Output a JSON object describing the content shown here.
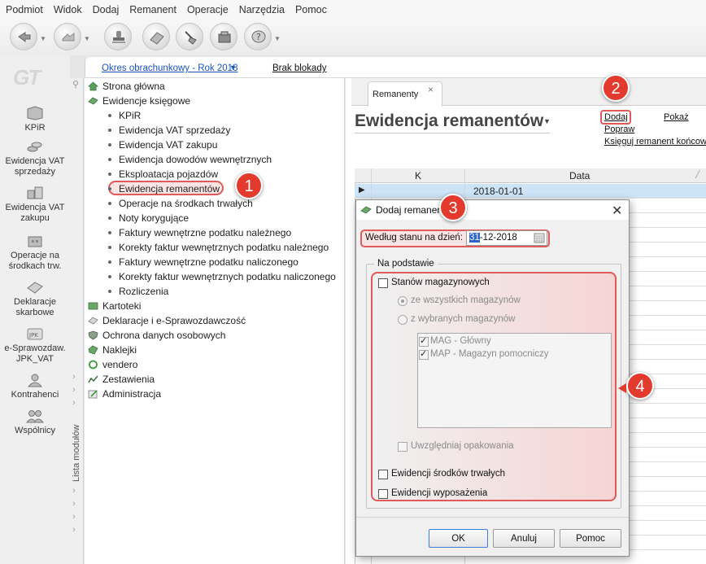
{
  "menu": [
    "Podmiot",
    "Widok",
    "Dodaj",
    "Remanent",
    "Operacje",
    "Narzędzia",
    "Pomoc"
  ],
  "toolbar_icons": [
    "back-arrow-icon",
    "forward-arrow-icon",
    "stamp-icon",
    "eraser-icon",
    "broom-icon",
    "register-icon",
    "help-icon"
  ],
  "logo": "GT",
  "left_nav": [
    {
      "label": "KPiR",
      "icon": "book-icon"
    },
    {
      "label": "Ewidencja VAT sprzedaży",
      "icon": "coins-icon"
    },
    {
      "label": "Ewidencja VAT zakupu",
      "icon": "boxes-icon"
    },
    {
      "label": "Operacje na środkach trw.",
      "icon": "building-icon"
    },
    {
      "label": "Deklaracje skarbowe",
      "icon": "forms-icon"
    },
    {
      "label": "e-Sprawozdaw. JPK_VAT",
      "icon": "jpk-icon"
    },
    {
      "label": "Kontrahenci",
      "icon": "person-icon"
    },
    {
      "label": "Wspólnicy",
      "icon": "people-icon"
    }
  ],
  "header": {
    "okres": "Okres obrachunkowy - Rok 2018",
    "brak": "Brak blokady"
  },
  "module_list_label": "Lista modułów",
  "tree": {
    "top": [
      {
        "label": "Strona główna",
        "icon": "home-icon"
      },
      {
        "label": "Ewidencje księgowe",
        "icon": "ledger-icon"
      }
    ],
    "sub": [
      "KPiR",
      "Ewidencja VAT sprzedaży",
      "Ewidencja VAT zakupu",
      "Ewidencja dowodów wewnętrznych",
      "Eksploatacja pojazdów",
      "Ewidencja remanentów",
      "Operacje na środkach trwałych",
      "Noty korygujące",
      "Faktury wewnętrzne podatku należnego",
      "Korekty faktur wewnętrznych podatku należnego",
      "Faktury wewnętrzne podatku naliczonego",
      "Korekty faktur wewnętrznych podatku naliczonego",
      "Rozliczenia"
    ],
    "bottom": [
      {
        "label": "Kartoteki",
        "icon": "cards-icon"
      },
      {
        "label": "Deklaracje i e-Sprawozdawczość",
        "icon": "declaration-icon"
      },
      {
        "label": "Ochrona danych osobowych",
        "icon": "shield-icon"
      },
      {
        "label": "Naklejki",
        "icon": "sticker-icon"
      },
      {
        "label": "vendero",
        "icon": "vendero-icon"
      },
      {
        "label": "Zestawienia",
        "icon": "chart-icon"
      },
      {
        "label": "Administracja",
        "icon": "admin-icon"
      }
    ]
  },
  "tab": {
    "label": "Remanenty",
    "close": "×"
  },
  "view": {
    "title": "Ewidencja remanentów",
    "actions": {
      "dodaj": "Dodaj",
      "pokaz": "Pokaż",
      "popraw": "Popraw",
      "ksieguj": "Księguj remanent końcowy"
    },
    "grid": {
      "headers": [
        "K",
        "Data"
      ],
      "rows": [
        {
          "date": "2018-01-01"
        }
      ]
    }
  },
  "dialog": {
    "title": "Dodaj remanent",
    "date_label": "Według stanu na dzień:",
    "date_day": "31",
    "date_rest": "-12-2018",
    "group_title": "Na podstawie",
    "stany_mag": "Stanów magazynowych",
    "radio_all": "ze wszystkich magazynów",
    "radio_selected": "z wybranych magazynów",
    "magazines": [
      "MAG - Główny",
      "MAP - Magazyn pomocniczy"
    ],
    "opakowania": "Uwzględniaj opakowania",
    "srodki": "Ewidencji środków trwałych",
    "wyposazenie": "Ewidencji wyposażenia",
    "ok": "OK",
    "anuluj": "Anuluj",
    "pomoc": "Pomoc"
  },
  "callouts": [
    "1",
    "2",
    "3",
    "4"
  ],
  "colors": {
    "accent_red": "#e23b2e",
    "highlight": "#e05a5a",
    "selection": "#cde3f6",
    "link": "#1a56b8"
  }
}
